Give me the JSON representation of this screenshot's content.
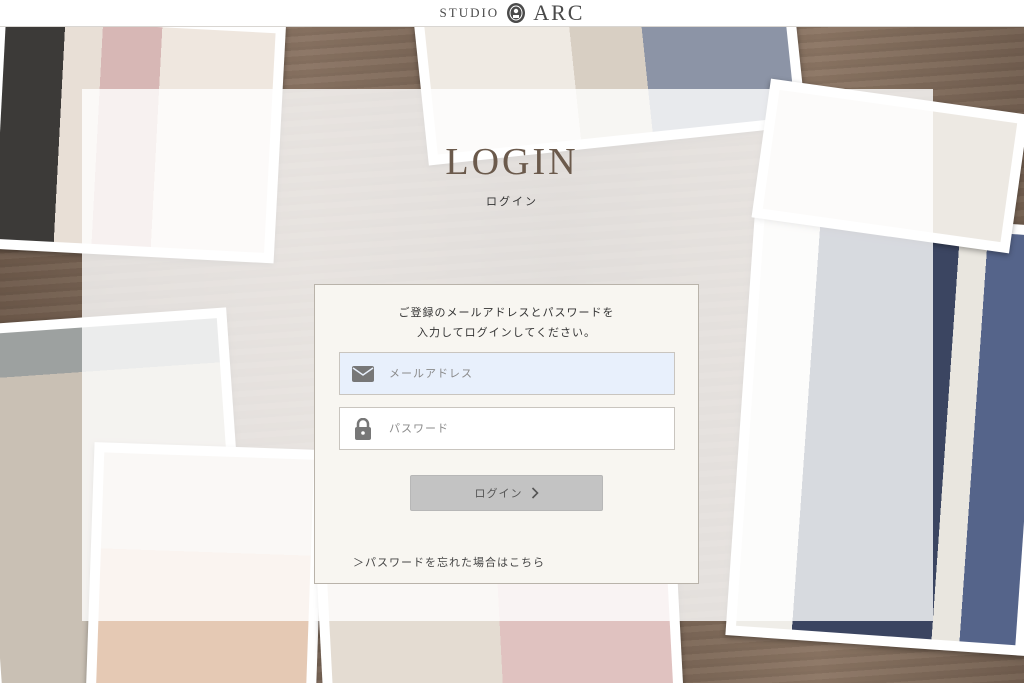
{
  "header": {
    "logo_studio": "STUDIO",
    "logo_arc": "ARC"
  },
  "login": {
    "title": "LOGIN",
    "subtitle": "ログイン",
    "instruction_line1": "ご登録のメールアドレスとパスワードを",
    "instruction_line2": "入力してログインしてください。",
    "email_placeholder": "メールアドレス",
    "email_value": "",
    "password_placeholder": "パスワード",
    "password_value": "",
    "submit_label": "ログイン",
    "forgot_link": "＞パスワードを忘れた場合はこちら"
  },
  "icons": {
    "logo": "studio-arc-crest-icon",
    "email": "envelope-icon",
    "password": "lock-icon",
    "submit": "chevron-right-icon"
  },
  "colors": {
    "title": "#6b5a4c",
    "email_field_bg": "#e8f0fc",
    "button_bg": "#c3c3c3",
    "panel_bg": "#f8f6f1",
    "icon_gray": "#777777"
  }
}
